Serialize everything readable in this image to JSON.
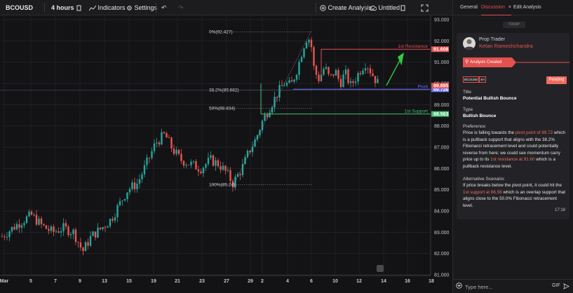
{
  "toolbar": {
    "symbol": "BCOUSD",
    "interval": "4 hours",
    "indicators_label": "Indicators",
    "settings_label": "Settings",
    "create_analysis_label": "Create Analysis",
    "untitled_label": "Untitled"
  },
  "chart_data": {
    "type": "candlestick",
    "symbol": "BCOUSD",
    "interval": "4 hours",
    "ylim": [
      81.0,
      93.0
    ],
    "y_ticks": [
      "93.000",
      "92.000",
      "91.000",
      "90.000",
      "89.000",
      "88.000",
      "87.000",
      "86.000",
      "85.000",
      "84.000",
      "83.000",
      "82.000",
      "81.000"
    ],
    "x_ticks": [
      "Mar",
      "5",
      "7",
      "9",
      "13",
      "15",
      "19",
      "21",
      "23",
      "27",
      "29",
      "2",
      "4",
      "6",
      "10",
      "12",
      "14",
      "16",
      "18"
    ],
    "fibonacci": [
      {
        "label": "0%(92.427)",
        "price": 92.427
      },
      {
        "label": "38.2%(89.682)",
        "price": 89.682
      },
      {
        "label": "50%(88.834)",
        "price": 88.834
      },
      {
        "label": "100%(85.24)",
        "price": 85.24
      }
    ],
    "lines": [
      {
        "label": "1st Resistance",
        "price": 91.608,
        "price_label": "91.608",
        "color": "#e2514e"
      },
      {
        "label": "Pivot",
        "price": 89.726,
        "price_label": "89.726",
        "color": "#6a70ff"
      },
      {
        "label": "1st Support",
        "price": 88.563,
        "price_label": "88.563",
        "color": "#3fbf6f"
      }
    ],
    "last_price": {
      "value": 89.895,
      "label": "89.895"
    },
    "colors": {
      "up": "#26a69a",
      "down": "#ef5350",
      "arrow": "#2ecc40"
    }
  },
  "panel": {
    "tabs": [
      "General",
      "Discussion",
      "Edit Analysis"
    ],
    "today_label": "TODAY",
    "author_role": "Prop Trader",
    "author_name": "Ketan Rameshchandra",
    "analysis_created": "Analysis Created",
    "tags": [
      "BCOUSD",
      "4H"
    ],
    "status": "Pending",
    "title_label": "Title",
    "title_value": "Potential Bullish Bounce",
    "type_label": "Type",
    "type_value": "Bullish Bounce",
    "preference_label": "Preference:",
    "preference": {
      "p1": "Price is falling towards the ",
      "h1": "pivot point of 89.72",
      "p2": " which is a pullback support that aligns with the 38.2% Fibonacci retracement level and could potentially reverse from here; we could see momentum carry price up to its ",
      "h2": "1st resistance at 91.60",
      "p3": " which is a pullback resistance level."
    },
    "alternative_label": "Alternative Scenario:",
    "alternative": {
      "p1": "If price breaks below the pivot point, it could hit the ",
      "h1": "1st support at 88.56",
      "p2": " which is an overlap support that aligns close to the 50.0% Fibonacci retracement level."
    },
    "time": "17:18",
    "chat_placeholder": "Type here...",
    "gif_label": "GIF"
  }
}
